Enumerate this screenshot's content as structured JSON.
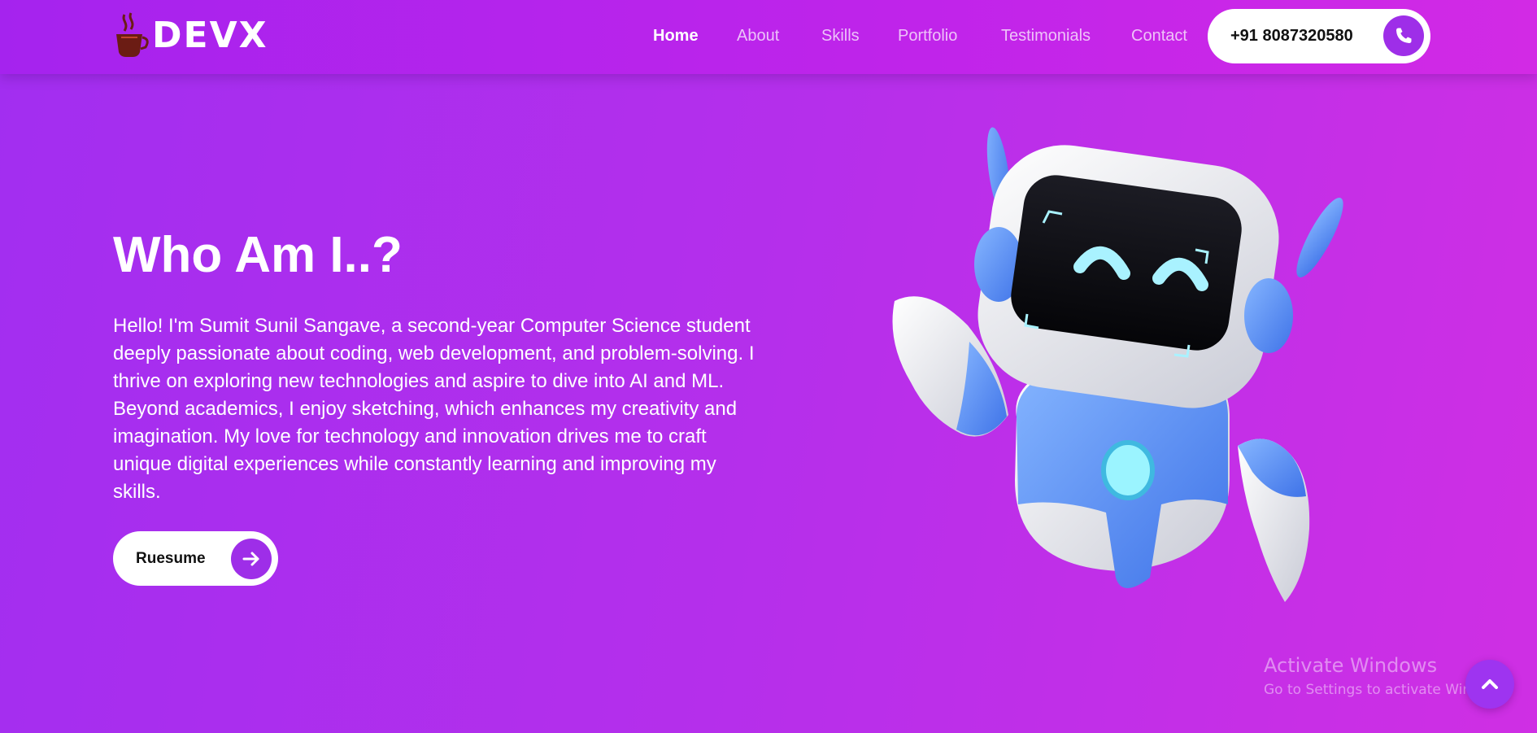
{
  "brand": {
    "name": "DEVX"
  },
  "nav": {
    "items": [
      {
        "label": "Home",
        "active": true
      },
      {
        "label": "About",
        "active": false
      },
      {
        "label": "Skills",
        "active": false
      },
      {
        "label": "Portfolio",
        "active": false
      },
      {
        "label": "Testimonials",
        "active": false
      },
      {
        "label": "Contact",
        "active": false
      }
    ],
    "phone": {
      "label": "+91 8087320580",
      "icon": "phone-icon"
    }
  },
  "hero": {
    "title": "Who Am I..?",
    "description": "Hello! I'm Sumit Sunil Sangave, a second-year Computer Science student deeply passionate about coding, web development, and problem-solving. I thrive on exploring new technologies and aspire to dive into AI and ML. Beyond academics, I enjoy sketching, which enhances my creativity and imagination. My love for technology and innovation drives me to craft unique digital experiences while constantly learning and improving my skills.",
    "button": {
      "label": "Ruesume",
      "icon": "arrow-right-icon"
    }
  },
  "watermark": {
    "title": "Activate Windows",
    "subtitle": "Go to Settings to activate Windows."
  },
  "scroll_top": {
    "icon": "chevron-up-icon"
  },
  "colors": {
    "accent": "#9e2ee8",
    "bg_start": "#a22ef0",
    "bg_end": "#cf2fe4",
    "robot_blue": "#4c8af2"
  }
}
